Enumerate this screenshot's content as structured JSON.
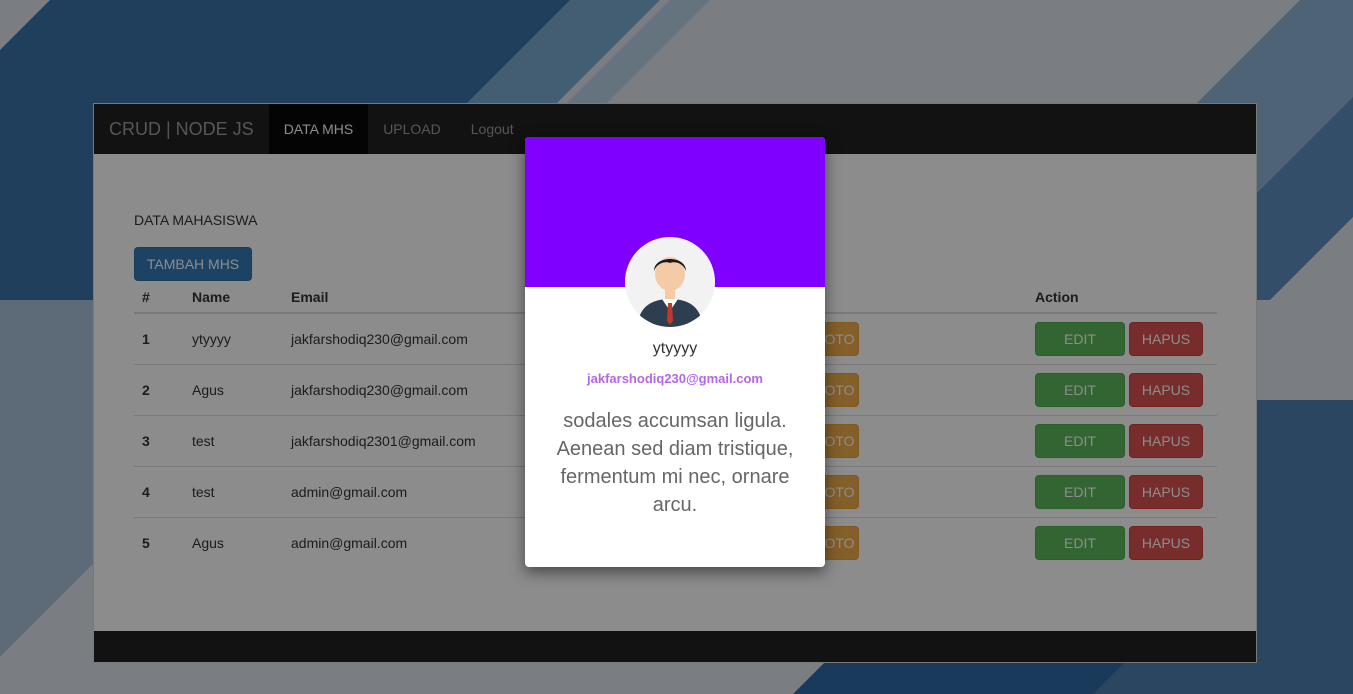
{
  "navbar": {
    "brand": "CRUD | NODE JS",
    "items": [
      {
        "label": "DATA MHS",
        "active": true
      },
      {
        "label": "UPLOAD",
        "active": false
      },
      {
        "label": "Logout",
        "active": false
      }
    ]
  },
  "page": {
    "heading": "DATA MAHASISWA",
    "add_button": "TAMBAH MHS"
  },
  "table": {
    "headers": [
      "#",
      "Name",
      "Email",
      "",
      "Action"
    ],
    "rows": [
      {
        "num": "1",
        "name": "ytyyyy",
        "email": "jakfarshodiq230@gmail.com"
      },
      {
        "num": "2",
        "name": "Agus",
        "email": "jakfarshodiq230@gmail.com"
      },
      {
        "num": "3",
        "name": "test",
        "email": "jakfarshodiq2301@gmail.com"
      },
      {
        "num": "4",
        "name": "test",
        "email": "admin@gmail.com"
      },
      {
        "num": "5",
        "name": "Agus",
        "email": "admin@gmail.com"
      }
    ],
    "foto_label": "UPLOAD FOTO",
    "edit_label": "EDIT",
    "hapus_label": "HAPUS"
  },
  "modal": {
    "name": "ytyyyy",
    "email": "jakfarshodiq230@gmail.com",
    "text": "sodales accumsan ligula. Aenean sed diam tristique, fermentum mi nec, ornare arcu.",
    "banner_color": "#7f00ff",
    "avatar_icon": "user-avatar-icon"
  },
  "colors": {
    "navbar": "#222222",
    "primary": "#337ab7",
    "warning": "#f0ad4e",
    "success": "#5cb85c",
    "danger": "#d9534f"
  }
}
